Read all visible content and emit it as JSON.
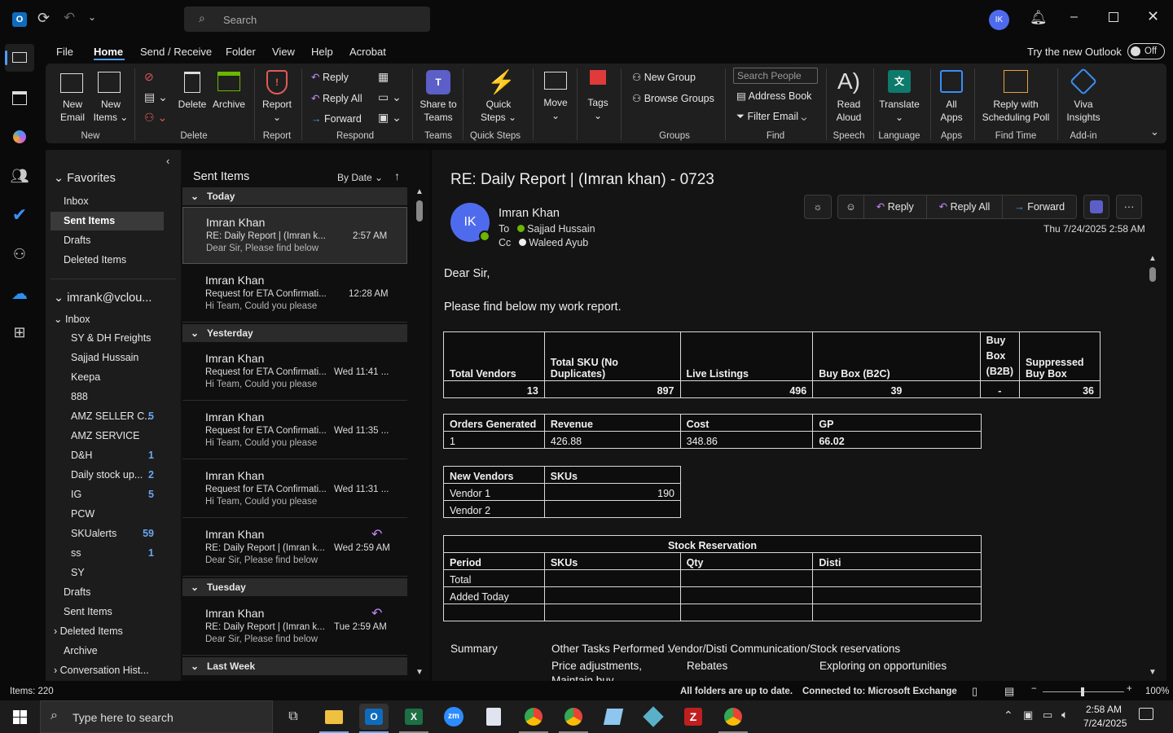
{
  "titlebar": {
    "search_placeholder": "Search",
    "avatar_initials": "IK"
  },
  "menu": {
    "file": "File",
    "home": "Home",
    "send_receive": "Send / Receive",
    "folder": "Folder",
    "view": "View",
    "help": "Help",
    "acrobat": "Acrobat",
    "try_new": "Try the new Outlook",
    "toggle": "Off"
  },
  "ribbon": {
    "new_email": [
      "New",
      "Email"
    ],
    "new_items": [
      "New",
      "Items"
    ],
    "delete": "Delete",
    "archive": "Archive",
    "report": "Report",
    "reply": "Reply",
    "reply_all": "Reply All",
    "forward": "Forward",
    "share_teams": [
      "Share to",
      "Teams"
    ],
    "quick_steps": [
      "Quick",
      "Steps"
    ],
    "move": "Move",
    "tags": "Tags",
    "new_group": "New Group",
    "browse_groups": "Browse Groups",
    "search_people": "Search People",
    "address_book": "Address Book",
    "filter_email": "Filter Email",
    "read_aloud": [
      "Read",
      "Aloud"
    ],
    "translate": "Translate",
    "all_apps": [
      "All",
      "Apps"
    ],
    "reply_poll": [
      "Reply with",
      "Scheduling Poll"
    ],
    "viva": [
      "Viva",
      "Insights"
    ],
    "groups": {
      "new": "New",
      "delete": "Delete",
      "report": "Report",
      "respond": "Respond",
      "teams": "Teams",
      "quick_steps": "Quick Steps",
      "groups": "Groups",
      "find": "Find",
      "speech": "Speech",
      "language": "Language",
      "apps": "Apps",
      "find_time": "Find Time",
      "addin": "Add-in"
    }
  },
  "folders": {
    "favorites": "Favorites",
    "fav_items": [
      "Inbox",
      "Sent Items",
      "Drafts",
      "Deleted Items"
    ],
    "account": "imrank@vclou...",
    "inbox": "Inbox",
    "subfolders": [
      {
        "name": "SY & DH Freights",
        "count": ""
      },
      {
        "name": "Sajjad Hussain",
        "count": ""
      },
      {
        "name": "Keepa",
        "count": ""
      },
      {
        "name": "888",
        "count": ""
      },
      {
        "name": "AMZ SELLER C...",
        "count": "5"
      },
      {
        "name": "AMZ SERVICE",
        "count": ""
      },
      {
        "name": "D&H",
        "count": "1"
      },
      {
        "name": "Daily stock up...",
        "count": "2"
      },
      {
        "name": "IG",
        "count": "5"
      },
      {
        "name": "PCW",
        "count": ""
      },
      {
        "name": "SKUalerts",
        "count": "59"
      },
      {
        "name": "ss",
        "count": "1"
      },
      {
        "name": "SY",
        "count": ""
      }
    ],
    "root_items": [
      "Drafts",
      "Sent Items",
      "Deleted Items",
      "Archive",
      "Conversation Hist..."
    ]
  },
  "list": {
    "title": "Sent Items",
    "sort": "By Date",
    "groups": [
      "Today",
      "Yesterday",
      "Tuesday",
      "Last Week"
    ],
    "messages": [
      {
        "sender": "Imran Khan",
        "subject": "RE: Daily Report | (Imran k...",
        "time": "2:57 AM",
        "preview": "Dear Sir, Please find below"
      },
      {
        "sender": "Imran Khan",
        "subject": "Request for ETA Confirmati...",
        "time": "12:28 AM",
        "preview": "Hi Team, Could you please"
      },
      {
        "sender": "Imran Khan",
        "subject": "Request for ETA Confirmati...",
        "time": "Wed 11:41 ...",
        "preview": "Hi Team, Could you please"
      },
      {
        "sender": "Imran Khan",
        "subject": "Request for ETA Confirmati...",
        "time": "Wed 11:35 ...",
        "preview": "Hi Team, Could you please"
      },
      {
        "sender": "Imran Khan",
        "subject": "Request for ETA Confirmati...",
        "time": "Wed 11:31 ...",
        "preview": "Hi Team, Could you please"
      },
      {
        "sender": "Imran Khan",
        "subject": "RE: Daily Report | (Imran k...",
        "time": "Wed 2:59 AM",
        "preview": "Dear Sir, Please find below"
      },
      {
        "sender": "Imran Khan",
        "subject": "RE: Daily Report | (Imran k...",
        "time": "Tue 2:59 AM",
        "preview": "Dear Sir, Please find below"
      }
    ]
  },
  "email": {
    "subject": "RE: Daily Report | (Imran khan) - 0723",
    "avatar": "IK",
    "from": "Imran Khan",
    "to_label": "To",
    "to": "Sajjad Hussain",
    "cc_label": "Cc",
    "cc": "Waleed Ayub",
    "date": "Thu 7/24/2025 2:58 AM",
    "reply": "Reply",
    "reply_all": "Reply All",
    "forward": "Forward",
    "greeting": "Dear Sir,",
    "intro": "Please find below my work report.",
    "t1": {
      "h": [
        "Total Vendors",
        "Total SKU (No Duplicates)",
        "Live Listings",
        "Buy Box (B2C)",
        "Buy Box (B2B)",
        "Suppressed Buy Box"
      ],
      "v": [
        "13",
        "897",
        "496",
        "39",
        "-",
        "36"
      ]
    },
    "t2": {
      "h": [
        "Orders Generated",
        "Revenue",
        "Cost",
        "GP"
      ],
      "v": [
        "1",
        "426.88",
        "348.86",
        "66.02"
      ]
    },
    "t3": {
      "h": [
        "New Vendors",
        "SKUs"
      ],
      "rows": [
        [
          "Vendor 1",
          "190"
        ],
        [
          "Vendor 2",
          ""
        ]
      ]
    },
    "t4": {
      "title": "Stock Reservation",
      "h": [
        "Period",
        "SKUs",
        "Qty",
        "Disti"
      ],
      "rows": [
        "Total",
        "Added Today",
        ""
      ]
    },
    "summary": "Summary",
    "other_tasks": "Other Tasks Performed :",
    "other_tasks_val": "Vendor/Disti Communication/Stock reservations",
    "price_adj": "Price adjustments,",
    "rebates": "Rebates",
    "exploring": "Exploring on opportunities",
    "maintain": "Maintain buy"
  },
  "status": {
    "items": "Items: 220",
    "sync": "All folders are up to date.",
    "conn": "Connected to: Microsoft Exchange",
    "zoom": "100%"
  },
  "taskbar": {
    "search": "Type here to search",
    "time": "2:58 AM",
    "date": "7/24/2025"
  },
  "colors": {
    "accent": "#4f6bed",
    "online": "#6bb700",
    "count": "#6aa7f0"
  }
}
